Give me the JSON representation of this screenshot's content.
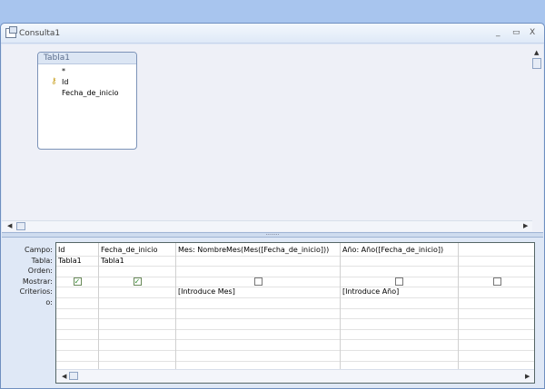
{
  "window": {
    "title": "Consulta1",
    "minimize": "_",
    "maximize": "▭",
    "close": "X"
  },
  "table_box": {
    "title": "Tabla1",
    "fields": [
      "*",
      "Id",
      "Fecha_de_inicio"
    ]
  },
  "grid": {
    "row_labels": [
      "Campo:",
      "Tabla:",
      "Orden:",
      "Mostrar:",
      "Criterios:",
      "o:"
    ],
    "columns": [
      {
        "campo": "Id",
        "tabla": "Tabla1",
        "mostrar": true,
        "criterios": ""
      },
      {
        "campo": "Fecha_de_inicio",
        "tabla": "Tabla1",
        "mostrar": true,
        "criterios": ""
      },
      {
        "campo": "Mes: NombreMes(Mes([Fecha_de_inicio]))",
        "tabla": "",
        "mostrar": false,
        "criterios": "[Introduce Mes]"
      },
      {
        "campo": "Año: Año([Fecha_de_inicio])",
        "tabla": "",
        "mostrar": false,
        "criterios": "[Introduce Año]"
      },
      {
        "campo": "",
        "tabla": "",
        "mostrar": false,
        "criterios": ""
      }
    ]
  }
}
